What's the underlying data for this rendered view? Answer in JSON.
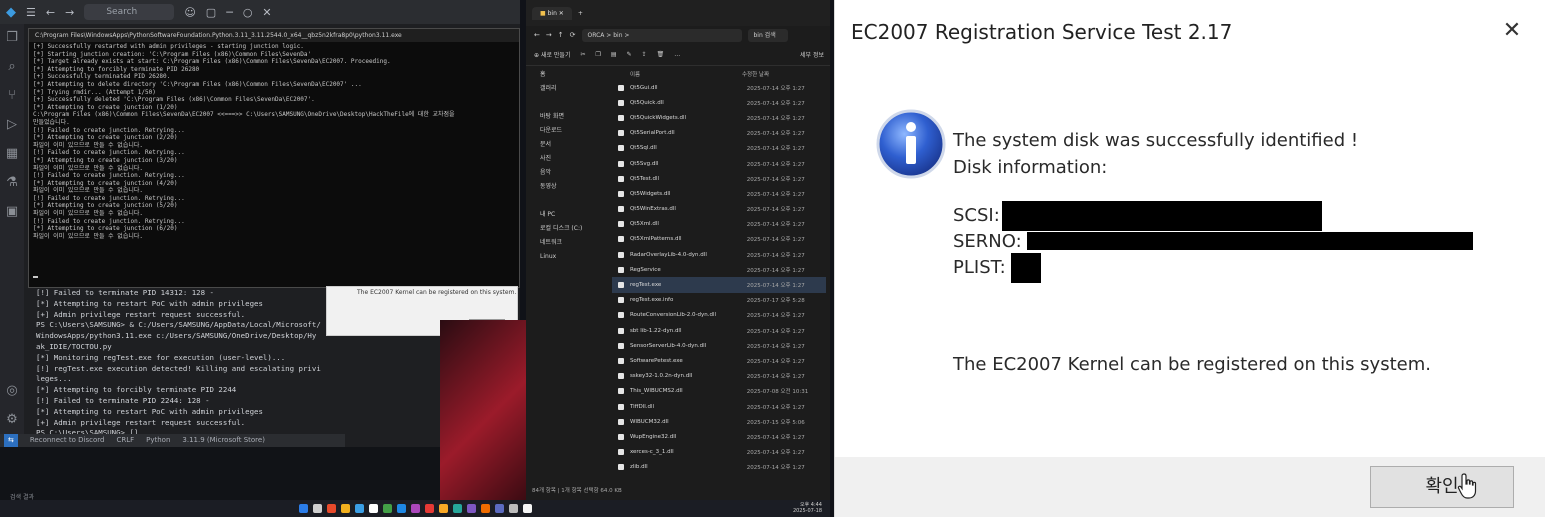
{
  "vscode": {
    "search_placeholder": "Search",
    "terminal_lines": [
      "[!] Failed to terminate PID 14312: 128 -",
      "[*] Attempting to restart PoC with admin privileges",
      "[+] Admin privilege restart request successful.",
      "PS C:\\Users\\SAMSUNG> & C:/Users/SAMSUNG/AppData/Local/Microsoft/",
      "WindowsApps/python3.11.exe c:/Users/SAMSUNG/OneDrive/Desktop/Hy",
      "ak_IDIE/TOCTOU.py",
      "[*] Monitoring regTest.exe for execution (user-level)...",
      "[!] regTest.exe execution detected! Killing and escalating privi",
      "leges...",
      "[*] Attempting to forcibly terminate PID 2244",
      "[!] Failed to terminate PID 2244: 128 -",
      "[*] Attempting to restart PoC with admin privileges",
      "[+] Admin privilege restart request successful.",
      "PS C:\\Users\\SAMSUNG> []"
    ],
    "status_items": [
      "Reconnect to Discord",
      "CRLF",
      "Python",
      "3.11.9 (Microsoft Store)"
    ],
    "bottom_hint": "검색 결과"
  },
  "console": {
    "title": "C:\\Program Files\\WindowsApps\\PythonSoftwareFoundation.Python.3.11_3.11.2544.0_x64__qbz5n2kfra8p0\\python3.11.exe",
    "lines": [
      "[+] Successfully restarted with admin privileges - starting junction logic.",
      "[*] Starting junction creation: 'C:\\Program Files (x86)\\Common Files\\SevenDa'",
      "[*] Target already exists at start: C:\\Program Files (x86)\\Common Files\\SevenDa\\EC2007. Proceeding.",
      "[*] Attempting to forcibly terminate PID 26280",
      "[+] Successfully terminated PID 26280.",
      "[*] Attempting to delete directory 'C:\\Program Files (x86)\\Common Files\\SevenDa\\EC2007' ...",
      "[*] Trying rmdir... (Attempt 1/50)",
      "[+] Successfully deleted 'C:\\Program Files (x86)\\Common Files\\SevenDa\\EC2007'.",
      "[*] Attempting to create junction (1/20)",
      "C:\\Program Files (x86)\\Common Files\\SevenDa\\EC2007 <<===>> C:\\Users\\SAMSUNG\\OneDrive\\Desktop\\HackTheFile에 대한 교차점을",
      "만들었습니다.",
      "[!] Failed to create junction. Retrying...",
      "[*] Attempting to create junction (2/20)",
      "파일이 이미 있으므로 만들 수 없습니다.",
      "[!] Failed to create junction. Retrying...",
      "[*] Attempting to create junction (3/20)",
      "파일이 이미 있으므로 만들 수 없습니다.",
      "[!] Failed to create junction. Retrying...",
      "[*] Attempting to create junction (4/20)",
      "파일이 이미 있으므로 만들 수 없습니다.",
      "[!] Failed to create junction. Retrying...",
      "[*] Attempting to create junction (5/20)",
      "파일이 이미 있으므로 만들 수 없습니다.",
      "[!] Failed to create junction. Retrying...",
      "[*] Attempting to create junction (6/20)",
      "파일이 이미 있으므로 만들 수 없습니다."
    ]
  },
  "mini_dialog": {
    "text": "The EC2007 Kernel can be registered on this system.",
    "ok_label": "확인"
  },
  "explorer": {
    "tab_title": "bin",
    "breadcrumb": "ORCA  >  bin  >",
    "search_placeholder": "bin 검색",
    "toolbar_new": "새로 만들기",
    "toolbar_details": "세부 정보",
    "header_name": "이름",
    "header_date": "수정한 날짜",
    "nav_items": [
      "홈",
      "갤러리",
      "바탕 화면",
      "다운로드",
      "문서",
      "사진",
      "음악",
      "동영상",
      "내 PC",
      "로컬 디스크 (C:)",
      "네트워크",
      "Linux"
    ],
    "files": [
      {
        "name": "Qt5Gui.dll",
        "date": "2025-07-14 오후 1:27"
      },
      {
        "name": "Qt5Quick.dll",
        "date": "2025-07-14 오후 1:27"
      },
      {
        "name": "Qt5QuickWidgets.dll",
        "date": "2025-07-14 오후 1:27"
      },
      {
        "name": "Qt5SerialPort.dll",
        "date": "2025-07-14 오후 1:27"
      },
      {
        "name": "Qt5Sql.dll",
        "date": "2025-07-14 오후 1:27"
      },
      {
        "name": "Qt5Svg.dll",
        "date": "2025-07-14 오후 1:27"
      },
      {
        "name": "Qt5Test.dll",
        "date": "2025-07-14 오후 1:27"
      },
      {
        "name": "Qt5Widgets.dll",
        "date": "2025-07-14 오후 1:27"
      },
      {
        "name": "Qt5WinExtras.dll",
        "date": "2025-07-14 오후 1:27"
      },
      {
        "name": "Qt5Xml.dll",
        "date": "2025-07-14 오후 1:27"
      },
      {
        "name": "Qt5XmlPatterns.dll",
        "date": "2025-07-14 오후 1:27"
      },
      {
        "name": "RadarOverlayLib-4.0-dyn.dll",
        "date": "2025-07-14 오후 1:27"
      },
      {
        "name": "RegService",
        "date": "2025-07-14 오후 1:27"
      },
      {
        "name": "regTest.exe",
        "date": "2025-07-14 오후 1:27"
      },
      {
        "name": "regTest.exe.info",
        "date": "2025-07-17 오후 5:28"
      },
      {
        "name": "RouteConversionLib-2.0-dyn.dll",
        "date": "2025-07-14 오후 1:27"
      },
      {
        "name": "sbt lib-1.22-dyn.dll",
        "date": "2025-07-14 오후 1:27"
      },
      {
        "name": "SensorServerLib-4.0-dyn.dll",
        "date": "2025-07-14 오후 1:27"
      },
      {
        "name": "SoftwarePetest.exe",
        "date": "2025-07-14 오후 1:27"
      },
      {
        "name": "sskey32-1.0.2n-dyn.dll",
        "date": "2025-07-14 오후 1:27"
      },
      {
        "name": "This_WIBUCMS2.dll",
        "date": "2025-07-08 오전 10:31"
      },
      {
        "name": "TiffDll.dll",
        "date": "2025-07-14 오후 1:27"
      },
      {
        "name": "WIBUCM32.dll",
        "date": "2025-07-15 오후 5:06"
      },
      {
        "name": "WupEngine32.dll",
        "date": "2025-07-14 오후 1:27"
      },
      {
        "name": "xerces-c_3_1.dll",
        "date": "2025-07-14 오후 1:27"
      },
      {
        "name": "zlib.dll",
        "date": "2025-07-14 오후 1:27"
      }
    ],
    "status": "84개 항목  |  1개 항목 선택함 64.0 KB"
  },
  "taskbar": {
    "tray_time": "오후 4:44",
    "tray_date": "2025-07-18",
    "icon_colors": [
      "#2b7de9",
      "#cfcfcf",
      "#e84a2b",
      "#f2b01e",
      "#3b9fe6",
      "#ffffff",
      "#43a047",
      "#1e88e5",
      "#ab47bc",
      "#e53935",
      "#f9a825",
      "#26a69a",
      "#7e57c2",
      "#ef6c00",
      "#5c6bc0",
      "#bdbdbd",
      "#f5f5f5"
    ]
  },
  "dialog": {
    "title": "EC2007 Registration Service Test 2.17",
    "message_line1": "The system disk was successfully identified !",
    "message_line2": "Disk information:",
    "scsi_label": "SCSI:",
    "serno_label": "SERNO:",
    "plist_label": "PLIST:",
    "kernel_message": "The EC2007 Kernel can be registered on this system.",
    "ok_label": "확인",
    "close_glyph": "✕"
  }
}
